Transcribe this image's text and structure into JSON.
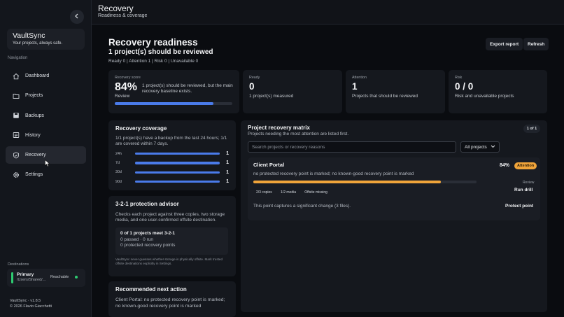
{
  "sidebar": {
    "brand_name": "VaultSync",
    "brand_tagline": "Your projects, always safe.",
    "nav_heading": "Navigation",
    "items": [
      {
        "label": "Dashboard",
        "icon": "home-icon"
      },
      {
        "label": "Projects",
        "icon": "folder-icon"
      },
      {
        "label": "Backups",
        "icon": "save-icon"
      },
      {
        "label": "History",
        "icon": "history-icon"
      },
      {
        "label": "Recovery",
        "icon": "shield-check-icon",
        "active": true
      },
      {
        "label": "Settings",
        "icon": "gear-icon"
      }
    ],
    "destinations_label": "Destinations",
    "destination": {
      "name": "Primary",
      "path": "/Users/Shared/...",
      "status": "Reachable",
      "status_color": "#2ecc71"
    },
    "version": "VaultSync · v1.8.5",
    "copyright": "© 2026 Flavio Giacchetti"
  },
  "header": {
    "title": "Recovery",
    "subtitle": "Readiness & coverage"
  },
  "main": {
    "title": "Recovery readiness",
    "subtitle": "1 project(s) should be reviewed",
    "meta": "Ready 0 | Attention 1 | Risk 0 | Unavailable 0",
    "export_label": "Export report",
    "refresh_label": "Refresh",
    "score": {
      "label": "Recovery score",
      "value": "84%",
      "status": "Review",
      "desc": "1 project(s) should be reviewed, but the main recovery baseline exists.",
      "progress": 0.84
    },
    "ready": {
      "label": "Ready",
      "value": "0",
      "desc": "1 project(s) measured"
    },
    "attention": {
      "label": "Attention",
      "value": "1",
      "desc": "Projects that should be reviewed"
    },
    "risk": {
      "label": "Risk",
      "value": "0 / 0",
      "desc": "Risk and unavailable projects"
    },
    "coverage": {
      "title": "Recovery coverage",
      "desc": "1/1 project(s) have a backup from the last 24 hours; 1/1 are covered within 7 days.",
      "rows": [
        {
          "label": "24h",
          "value": "1",
          "fill": 1.0
        },
        {
          "label": "7d",
          "value": "1",
          "fill": 1.0
        },
        {
          "label": "30d",
          "value": "1",
          "fill": 1.0
        },
        {
          "label": "90d",
          "value": "1",
          "fill": 1.0
        }
      ]
    },
    "advisor": {
      "title": "3-2-1 protection advisor",
      "desc": "Checks each project against three copies, two storage media, and one user-confirmed offsite destination.",
      "box_title": "0 of 1 projects meet 3-2-1",
      "box_line1": "0 passed · 0 run",
      "box_line2": "0 protected recovery points",
      "note": "VaultSync never guesses whether storage is physically offsite. Mark trusted offsite destinations explicitly in Settings."
    },
    "next_action": {
      "title": "Recommended next action",
      "desc": "Client Portal: no protected recovery point is marked; no known-good recovery point is marked"
    },
    "matrix": {
      "title": "Project recovery matrix",
      "desc": "Projects needing the most attention are listed first.",
      "page": "1 of 1",
      "search_placeholder": "Search projects or recovery reasons",
      "filter_value": "All projects",
      "project": {
        "name": "Client Portal",
        "score": "84%",
        "badge": "Attention",
        "reason": "no protected recovery point is marked; no known-good recovery point is marked",
        "progress": 0.84,
        "status": "Review",
        "tags": [
          "2/3 copies",
          "1/2 media",
          "Offsite missing"
        ],
        "run_drill_label": "Run drill",
        "note": "This point captures a significant change (3 files).",
        "protect_label": "Protect point"
      }
    }
  }
}
